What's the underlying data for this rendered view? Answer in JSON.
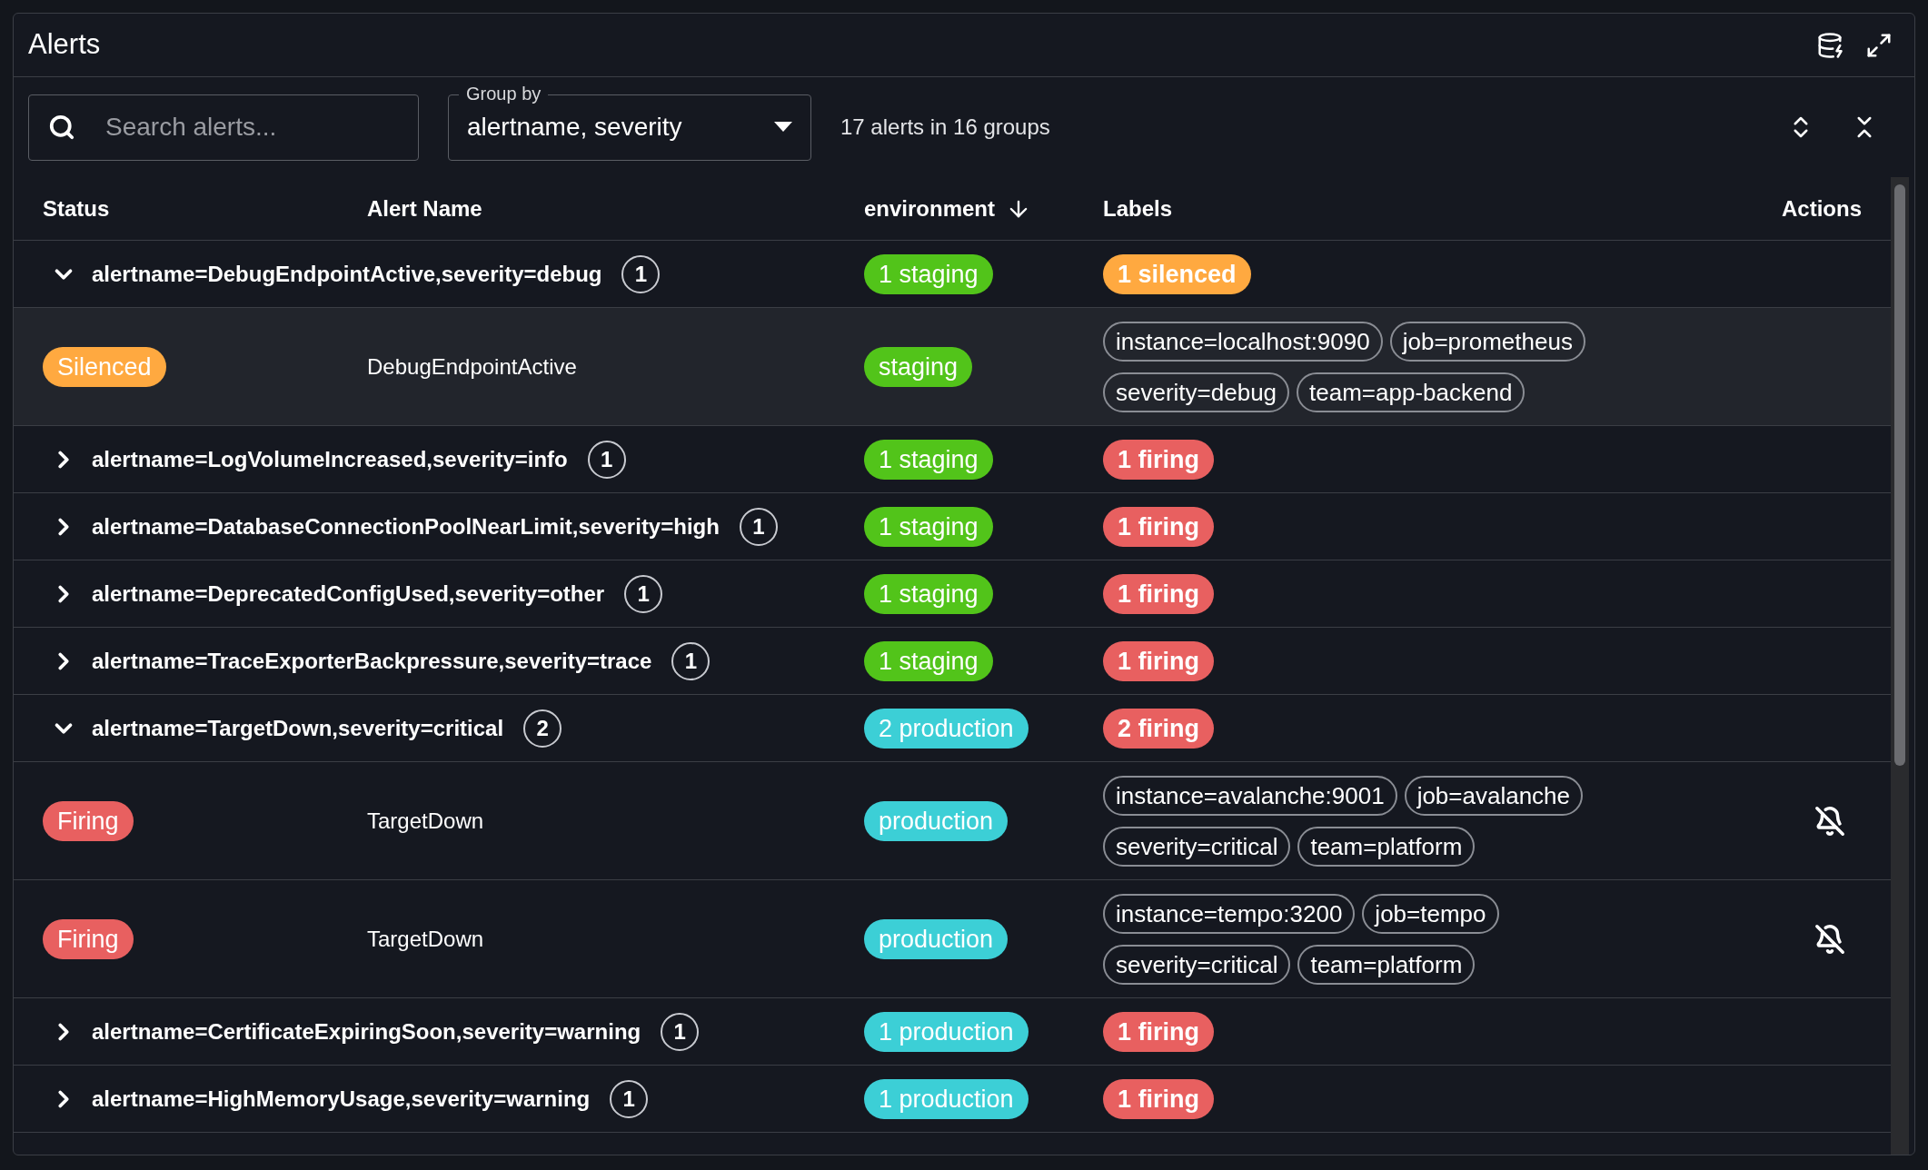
{
  "panel": {
    "title": "Alerts"
  },
  "toolbar": {
    "search": {
      "placeholder": "Search alerts..."
    },
    "group_by": {
      "label": "Group by",
      "value": "alertname, severity"
    },
    "summary": "17 alerts in 16 groups"
  },
  "table": {
    "columns": [
      {
        "label": "Status",
        "sorted": false
      },
      {
        "label": "Alert Name",
        "sorted": false
      },
      {
        "label": "environment",
        "sorted": true
      },
      {
        "label": "Labels",
        "sorted": false
      },
      {
        "label": "Actions",
        "sorted": false
      }
    ],
    "groups": [
      {
        "name": "alertname=DebugEndpointActive,severity=debug",
        "count": "1",
        "expanded": true,
        "environment": {
          "text": "1 staging",
          "color": "#52c41a"
        },
        "state": {
          "text": "1 silenced",
          "color": "#ffa940"
        },
        "alerts": [
          {
            "status": {
              "text": "Silenced",
              "color": "#ffa940"
            },
            "name": "DebugEndpointActive",
            "environment": {
              "text": "staging",
              "color": "#52c41a"
            },
            "labels": [
              "instance=localhost:9090",
              "job=prometheus",
              "severity=debug",
              "team=app-backend"
            ],
            "silence_action": false
          }
        ]
      },
      {
        "name": "alertname=LogVolumeIncreased,severity=info",
        "count": "1",
        "expanded": false,
        "environment": {
          "text": "1 staging",
          "color": "#52c41a"
        },
        "state": {
          "text": "1 firing",
          "color": "#e86060"
        }
      },
      {
        "name": "alertname=DatabaseConnectionPoolNearLimit,severity=high",
        "count": "1",
        "expanded": false,
        "environment": {
          "text": "1 staging",
          "color": "#52c41a"
        },
        "state": {
          "text": "1 firing",
          "color": "#e86060"
        }
      },
      {
        "name": "alertname=DeprecatedConfigUsed,severity=other",
        "count": "1",
        "expanded": false,
        "environment": {
          "text": "1 staging",
          "color": "#52c41a"
        },
        "state": {
          "text": "1 firing",
          "color": "#e86060"
        }
      },
      {
        "name": "alertname=TraceExporterBackpressure,severity=trace",
        "count": "1",
        "expanded": false,
        "environment": {
          "text": "1 staging",
          "color": "#52c41a"
        },
        "state": {
          "text": "1 firing",
          "color": "#e86060"
        }
      },
      {
        "name": "alertname=TargetDown,severity=critical",
        "count": "2",
        "expanded": true,
        "environment": {
          "text": "2 production",
          "color": "#3ccfd6"
        },
        "state": {
          "text": "2 firing",
          "color": "#e86060"
        },
        "alerts": [
          {
            "status": {
              "text": "Firing",
              "color": "#e86060"
            },
            "name": "TargetDown",
            "environment": {
              "text": "production",
              "color": "#3ccfd6"
            },
            "labels": [
              "instance=avalanche:9001",
              "job=avalanche",
              "severity=critical",
              "team=platform"
            ],
            "silence_action": true
          },
          {
            "status": {
              "text": "Firing",
              "color": "#e86060"
            },
            "name": "TargetDown",
            "environment": {
              "text": "production",
              "color": "#3ccfd6"
            },
            "labels": [
              "instance=tempo:3200",
              "job=tempo",
              "severity=critical",
              "team=platform"
            ],
            "silence_action": true
          }
        ]
      },
      {
        "name": "alertname=CertificateExpiringSoon,severity=warning",
        "count": "1",
        "expanded": false,
        "environment": {
          "text": "1 production",
          "color": "#3ccfd6"
        },
        "state": {
          "text": "1 firing",
          "color": "#e86060"
        }
      },
      {
        "name": "alertname=HighMemoryUsage,severity=warning",
        "count": "1",
        "expanded": false,
        "environment": {
          "text": "1 production",
          "color": "#3ccfd6"
        },
        "state": {
          "text": "1 firing",
          "color": "#e86060"
        }
      }
    ]
  }
}
